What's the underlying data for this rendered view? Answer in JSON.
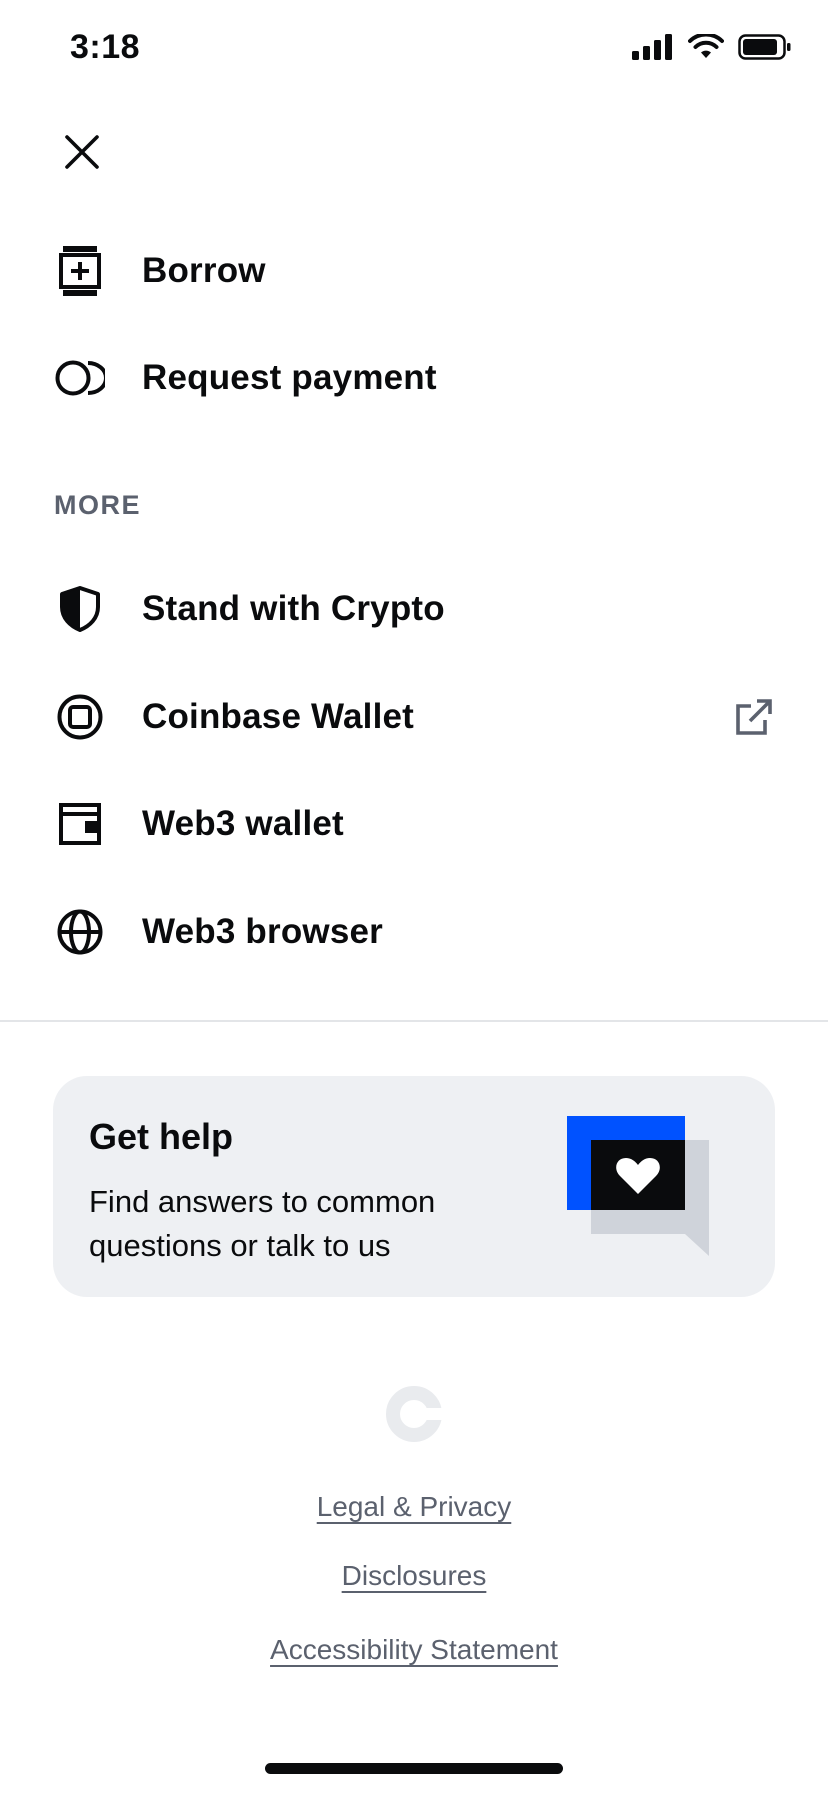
{
  "status_bar": {
    "time": "3:18"
  },
  "menu": {
    "top_items": [
      {
        "label": "Borrow",
        "icon": "borrow-icon"
      },
      {
        "label": "Request payment",
        "icon": "request-payment-icon"
      }
    ],
    "section_label": "MORE",
    "more_items": [
      {
        "label": "Stand with Crypto",
        "icon": "shield-icon"
      },
      {
        "label": "Coinbase Wallet",
        "icon": "coinbase-wallet-icon",
        "external": true
      },
      {
        "label": "Web3 wallet",
        "icon": "wallet-icon"
      },
      {
        "label": "Web3 browser",
        "icon": "globe-icon"
      }
    ]
  },
  "help_card": {
    "title": "Get help",
    "description": "Find answers to common questions or talk to us"
  },
  "footer": {
    "links": [
      "Legal & Privacy",
      "Disclosures",
      "Accessibility Statement"
    ]
  },
  "colors": {
    "accent": "#0052ff",
    "text": "#0a0b0d",
    "muted": "#5b616e",
    "card_bg": "#eef0f3"
  }
}
